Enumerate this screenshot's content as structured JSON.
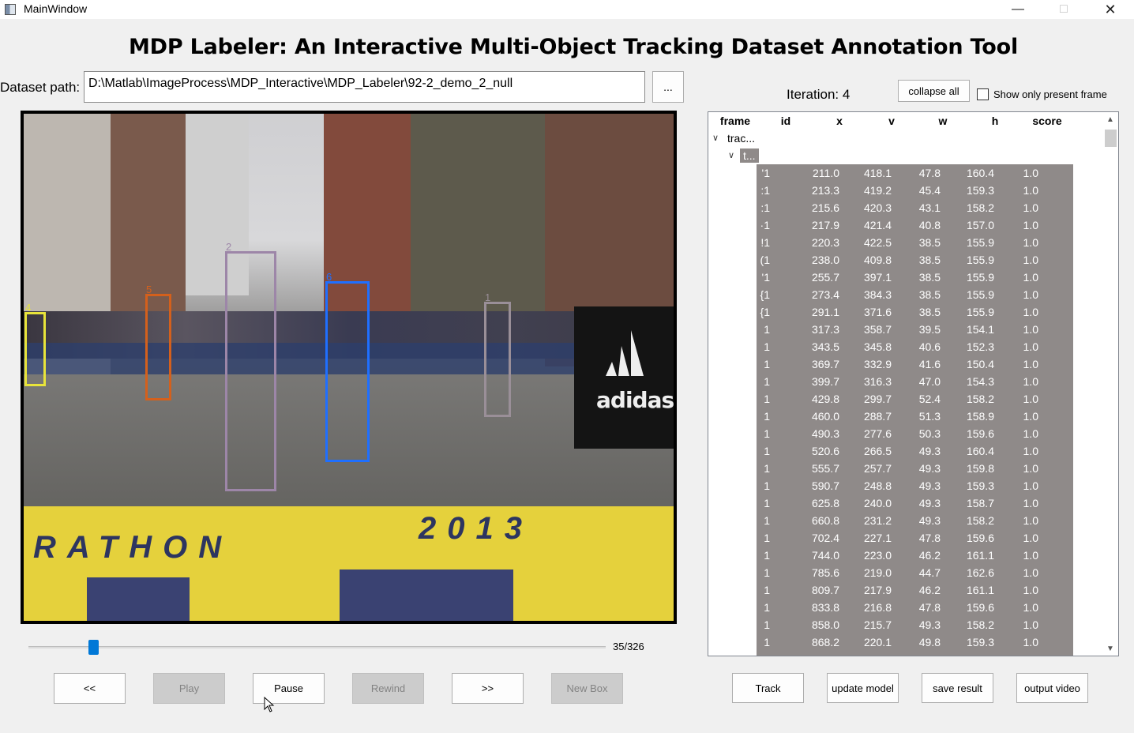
{
  "window": {
    "title": "MainWindow",
    "minimize": "—",
    "maximize": "□",
    "close": "✕"
  },
  "heading": "MDP Labeler: An Interactive Multi-Object Tracking Dataset Annotation Tool",
  "dataset": {
    "label": "Dataset path:",
    "path": "D:\\Matlab\\ImageProcess\\MDP_Interactive\\MDP_Labeler\\92-2_demo_2_null",
    "browse_label": "..."
  },
  "iteration_text": "Iteration: 4",
  "collapse_label": "collapse all",
  "show_only_label": "Show only present frame",
  "video": {
    "tracks": [
      {
        "id": "4",
        "color": "#e8e43a"
      },
      {
        "id": "5",
        "color": "#d4601c"
      },
      {
        "id": "2",
        "color": "#9d86a8"
      },
      {
        "id": "6",
        "color": "#1f6fff"
      },
      {
        "id": "1",
        "color": "#9a8f98"
      }
    ],
    "mat_text_left": "RATHON",
    "mat_text_right": "2013",
    "ad_text": "adidas"
  },
  "slider": {
    "frame_text": "35/326",
    "position": 0.107
  },
  "buttons": {
    "prev": "<<",
    "play": "Play",
    "pause": "Pause",
    "rewind": "Rewind",
    "next": ">>",
    "new_box": "New Box",
    "track": "Track",
    "update_model": "update model",
    "save_result": "save result",
    "output_video": "output video"
  },
  "tree": {
    "columns": [
      "frame",
      "id",
      "x",
      "v",
      "w",
      "h",
      "score"
    ],
    "root_label": "trac...",
    "child_label": "t...",
    "rows": [
      {
        "frame": "'1",
        "x": "211.0",
        "v": "418.1",
        "w": "47.8",
        "h": "160.4",
        "score": "1.0"
      },
      {
        "frame": ":1",
        "x": "213.3",
        "v": "419.2",
        "w": "45.4",
        "h": "159.3",
        "score": "1.0"
      },
      {
        "frame": ":1",
        "x": "215.6",
        "v": "420.3",
        "w": "43.1",
        "h": "158.2",
        "score": "1.0"
      },
      {
        "frame": "·1",
        "x": "217.9",
        "v": "421.4",
        "w": "40.8",
        "h": "157.0",
        "score": "1.0"
      },
      {
        "frame": "!1",
        "x": "220.3",
        "v": "422.5",
        "w": "38.5",
        "h": "155.9",
        "score": "1.0"
      },
      {
        "frame": "(1",
        "x": "238.0",
        "v": "409.8",
        "w": "38.5",
        "h": "155.9",
        "score": "1.0"
      },
      {
        "frame": "'1",
        "x": "255.7",
        "v": "397.1",
        "w": "38.5",
        "h": "155.9",
        "score": "1.0"
      },
      {
        "frame": "{1",
        "x": "273.4",
        "v": "384.3",
        "w": "38.5",
        "h": "155.9",
        "score": "1.0"
      },
      {
        "frame": "{1",
        "x": "291.1",
        "v": "371.6",
        "w": "38.5",
        "h": "155.9",
        "score": "1.0"
      },
      {
        "frame": "1",
        "x": "317.3",
        "v": "358.7",
        "w": "39.5",
        "h": "154.1",
        "score": "1.0"
      },
      {
        "frame": "1",
        "x": "343.5",
        "v": "345.8",
        "w": "40.6",
        "h": "152.3",
        "score": "1.0"
      },
      {
        "frame": "1",
        "x": "369.7",
        "v": "332.9",
        "w": "41.6",
        "h": "150.4",
        "score": "1.0"
      },
      {
        "frame": "1",
        "x": "399.7",
        "v": "316.3",
        "w": "47.0",
        "h": "154.3",
        "score": "1.0"
      },
      {
        "frame": "1",
        "x": "429.8",
        "v": "299.7",
        "w": "52.4",
        "h": "158.2",
        "score": "1.0"
      },
      {
        "frame": "1",
        "x": "460.0",
        "v": "288.7",
        "w": "51.3",
        "h": "158.9",
        "score": "1.0"
      },
      {
        "frame": "1",
        "x": "490.3",
        "v": "277.6",
        "w": "50.3",
        "h": "159.6",
        "score": "1.0"
      },
      {
        "frame": "1",
        "x": "520.6",
        "v": "266.5",
        "w": "49.3",
        "h": "160.4",
        "score": "1.0"
      },
      {
        "frame": "1",
        "x": "555.7",
        "v": "257.7",
        "w": "49.3",
        "h": "159.8",
        "score": "1.0"
      },
      {
        "frame": "1",
        "x": "590.7",
        "v": "248.8",
        "w": "49.3",
        "h": "159.3",
        "score": "1.0"
      },
      {
        "frame": "1",
        "x": "625.8",
        "v": "240.0",
        "w": "49.3",
        "h": "158.7",
        "score": "1.0"
      },
      {
        "frame": "1",
        "x": "660.8",
        "v": "231.2",
        "w": "49.3",
        "h": "158.2",
        "score": "1.0"
      },
      {
        "frame": "1",
        "x": "702.4",
        "v": "227.1",
        "w": "47.8",
        "h": "159.6",
        "score": "1.0"
      },
      {
        "frame": "1",
        "x": "744.0",
        "v": "223.0",
        "w": "46.2",
        "h": "161.1",
        "score": "1.0"
      },
      {
        "frame": "1",
        "x": "785.6",
        "v": "219.0",
        "w": "44.7",
        "h": "162.6",
        "score": "1.0"
      },
      {
        "frame": "1",
        "x": "809.7",
        "v": "217.9",
        "w": "46.2",
        "h": "161.1",
        "score": "1.0"
      },
      {
        "frame": "1",
        "x": "833.8",
        "v": "216.8",
        "w": "47.8",
        "h": "159.6",
        "score": "1.0"
      },
      {
        "frame": "1",
        "x": "858.0",
        "v": "215.7",
        "w": "49.3",
        "h": "158.2",
        "score": "1.0"
      },
      {
        "frame": "1",
        "x": "868.2",
        "v": "220.1",
        "w": "49.8",
        "h": "159.3",
        "score": "1.0"
      }
    ]
  }
}
